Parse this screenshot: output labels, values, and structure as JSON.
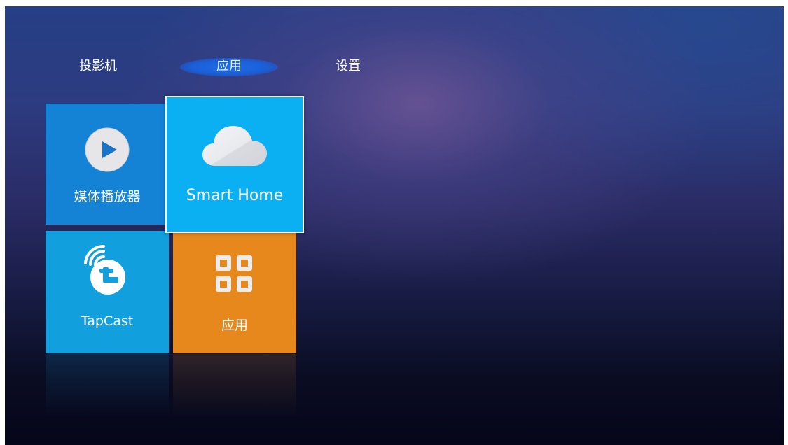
{
  "nav": {
    "tabs": [
      {
        "label": "投影机"
      },
      {
        "label": "应用",
        "selected": true
      },
      {
        "label": "设置"
      }
    ]
  },
  "tiles": {
    "media_player": {
      "label": "媒体播放器",
      "icon": "play-circle-icon",
      "color": "#1483d6"
    },
    "smart_home": {
      "label": "Smart Home",
      "icon": "cloud-icon",
      "color": "#0ab0f2",
      "focused": true
    },
    "tapcast": {
      "label": "TapCast",
      "icon": "tapcast-icon",
      "color": "#119fde"
    },
    "apps": {
      "label": "应用",
      "icon": "grid-icon",
      "color": "#e6881c"
    }
  }
}
